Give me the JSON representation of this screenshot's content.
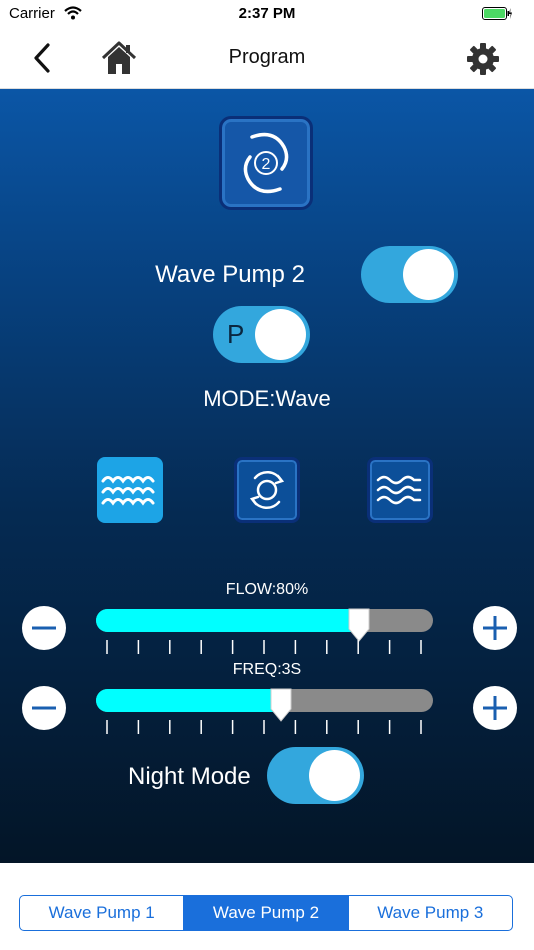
{
  "status_bar": {
    "carrier": "Carrier",
    "time": "2:37 PM"
  },
  "nav": {
    "title": "Program",
    "back_icon": "chevron-left-icon",
    "home_icon": "home-icon",
    "settings_icon": "gear-icon"
  },
  "pump": {
    "icon": "wave-pump-icon",
    "icon_number": "2",
    "name": "Wave Pump 2",
    "power_on": true,
    "program_toggle_label": "P",
    "program_on": true
  },
  "mode": {
    "label": "MODE:Wave",
    "options": [
      {
        "icon": "wave-mode-icon",
        "selected": true
      },
      {
        "icon": "circular-mode-icon",
        "selected": false
      },
      {
        "icon": "flow-mode-icon",
        "selected": false
      }
    ]
  },
  "flow": {
    "label": "FLOW:80%",
    "fraction": 0.78
  },
  "freq": {
    "label": "FREQ:3S",
    "fraction": 0.55
  },
  "night_mode": {
    "label": "Night Mode",
    "on": true
  },
  "tabs": [
    {
      "label": "Wave Pump 1",
      "active": false
    },
    {
      "label": "Wave Pump 2",
      "active": true
    },
    {
      "label": "Wave Pump 3",
      "active": false
    }
  ],
  "colors": {
    "accent": "#1a6fdb",
    "toggle_on": "#33a7dd",
    "slider_fill": "#00ffff",
    "slider_track": "#8a8a8a"
  }
}
